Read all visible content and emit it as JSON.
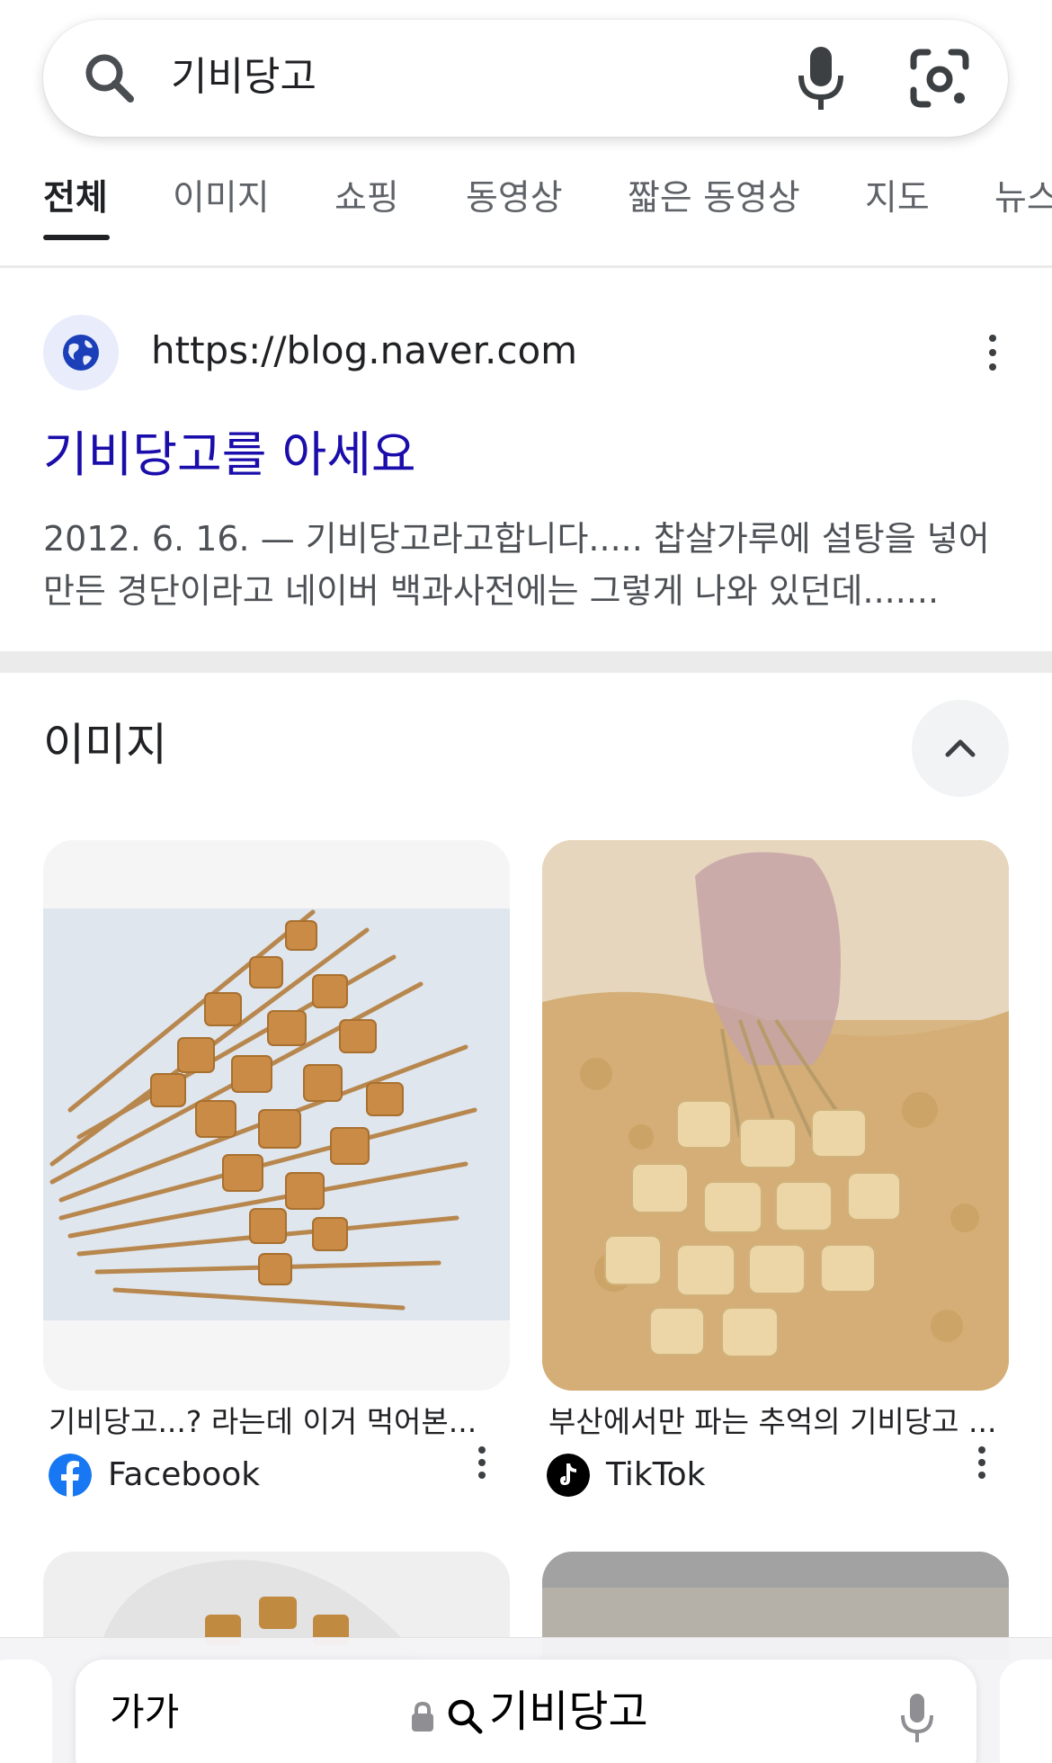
{
  "search": {
    "query": "기비당고",
    "search_icon": "search-icon",
    "mic_icon": "microphone-icon",
    "lens_icon": "camera-lens-icon"
  },
  "tabs": [
    {
      "label": "전체",
      "active": true
    },
    {
      "label": "이미지"
    },
    {
      "label": "쇼핑"
    },
    {
      "label": "동영상"
    },
    {
      "label": "짧은 동영상"
    },
    {
      "label": "지도"
    },
    {
      "label": "뉴스"
    }
  ],
  "result": {
    "url": "https://blog.naver.com",
    "title": "기비당고를 아세요",
    "snippet_line1": "2012. 6. 16. — 기비당고라고합니다..... 찹살가루에 설탕을 넣어",
    "snippet_line2": "만든 경단이라고 네이버 백과사전에는 그렇게 나와 있던데......."
  },
  "images_section": {
    "heading": "이미지",
    "collapse_icon": "chevron-up-icon",
    "items": [
      {
        "caption": "기비당고...? 라는데 이거 먹어본...",
        "source": "Facebook",
        "source_color": "#1877f2"
      },
      {
        "caption": "부산에서만 파는 추억의 기비당고 ...",
        "source": "TikTok",
        "source_color": "#000000"
      }
    ]
  },
  "address_bar": {
    "aa_label": "가가",
    "text": "기비당고"
  },
  "colors": {
    "link": "#1a0dab",
    "text": "#202124",
    "muted": "#5f6368"
  }
}
